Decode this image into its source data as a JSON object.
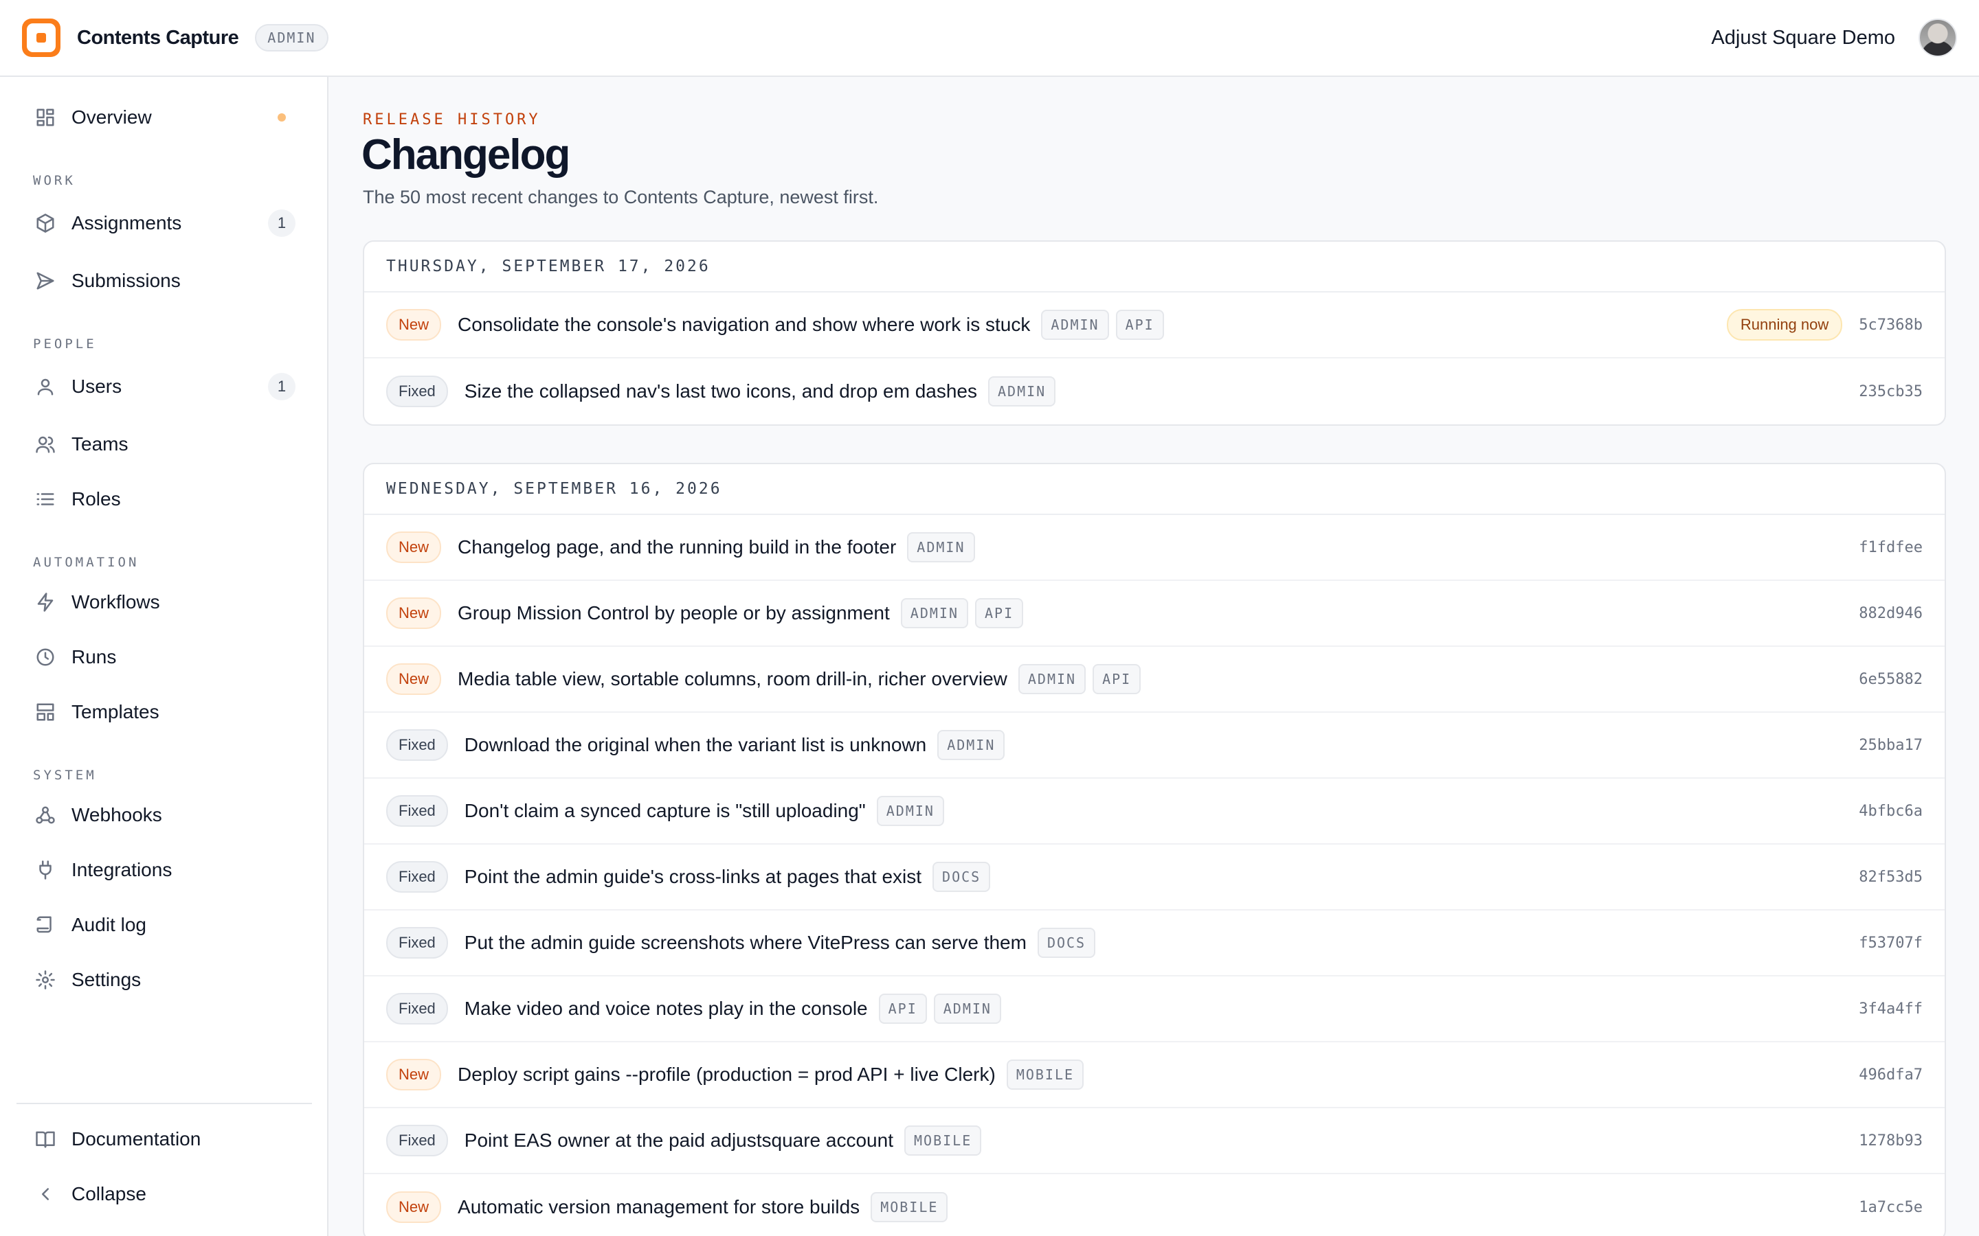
{
  "header": {
    "app_name": "Contents Capture",
    "role_badge": "ADMIN",
    "org_name": "Adjust Square Demo"
  },
  "sidebar": {
    "overview": "Overview",
    "sections": {
      "work": "WORK",
      "people": "PEOPLE",
      "automation": "AUTOMATION",
      "system": "SYSTEM"
    },
    "items": {
      "assignments": {
        "label": "Assignments",
        "count": "1",
        "icon": "box-icon"
      },
      "submissions": {
        "label": "Submissions",
        "icon": "send-icon"
      },
      "users": {
        "label": "Users",
        "count": "1",
        "icon": "user-icon"
      },
      "teams": {
        "label": "Teams",
        "icon": "users-icon"
      },
      "roles": {
        "label": "Roles",
        "icon": "list-icon"
      },
      "workflows": {
        "label": "Workflows",
        "icon": "bolt-icon"
      },
      "runs": {
        "label": "Runs",
        "icon": "clock-icon"
      },
      "templates": {
        "label": "Templates",
        "icon": "layout-icon"
      },
      "webhooks": {
        "label": "Webhooks",
        "icon": "webhook-icon"
      },
      "integrations": {
        "label": "Integrations",
        "icon": "plug-icon"
      },
      "audit_log": {
        "label": "Audit log",
        "icon": "scroll-icon"
      },
      "settings": {
        "label": "Settings",
        "icon": "gear-icon"
      }
    },
    "documentation": "Documentation",
    "collapse": "Collapse"
  },
  "page": {
    "eyebrow": "RELEASE HISTORY",
    "title": "Changelog",
    "subtitle": "The 50 most recent changes to Contents Capture, newest first."
  },
  "changelog": [
    {
      "date": "THURSDAY, SEPTEMBER 17, 2026",
      "entries": [
        {
          "kind": "New",
          "text": "Consolidate the console's navigation and show where work is stuck",
          "tags": [
            "ADMIN",
            "API"
          ],
          "status": "Running now",
          "hash": "5c7368b"
        },
        {
          "kind": "Fixed",
          "text": "Size the collapsed nav's last two icons, and drop em dashes",
          "tags": [
            "ADMIN"
          ],
          "hash": "235cb35"
        }
      ]
    },
    {
      "date": "WEDNESDAY, SEPTEMBER 16, 2026",
      "entries": [
        {
          "kind": "New",
          "text": "Changelog page, and the running build in the footer",
          "tags": [
            "ADMIN"
          ],
          "hash": "f1fdfee"
        },
        {
          "kind": "New",
          "text": "Group Mission Control by people or by assignment",
          "tags": [
            "ADMIN",
            "API"
          ],
          "hash": "882d946"
        },
        {
          "kind": "New",
          "text": "Media table view, sortable columns, room drill-in, richer overview",
          "tags": [
            "ADMIN",
            "API"
          ],
          "hash": "6e55882"
        },
        {
          "kind": "Fixed",
          "text": "Download the original when the variant list is unknown",
          "tags": [
            "ADMIN"
          ],
          "hash": "25bba17"
        },
        {
          "kind": "Fixed",
          "text": "Don't claim a synced capture is \"still uploading\"",
          "tags": [
            "ADMIN"
          ],
          "hash": "4bfbc6a"
        },
        {
          "kind": "Fixed",
          "text": "Point the admin guide's cross-links at pages that exist",
          "tags": [
            "DOCS"
          ],
          "hash": "82f53d5"
        },
        {
          "kind": "Fixed",
          "text": "Put the admin guide screenshots where VitePress can serve them",
          "tags": [
            "DOCS"
          ],
          "hash": "f53707f"
        },
        {
          "kind": "Fixed",
          "text": "Make video and voice notes play in the console",
          "tags": [
            "API",
            "ADMIN"
          ],
          "hash": "3f4a4ff"
        },
        {
          "kind": "New",
          "text": "Deploy script gains --profile (production = prod API + live Clerk)",
          "tags": [
            "MOBILE"
          ],
          "hash": "496dfa7"
        },
        {
          "kind": "Fixed",
          "text": "Point EAS owner at the paid adjustsquare account",
          "tags": [
            "MOBILE"
          ],
          "hash": "1278b93"
        },
        {
          "kind": "New",
          "text": "Automatic version management for store builds",
          "tags": [
            "MOBILE"
          ],
          "hash": "1a7cc5e"
        }
      ]
    }
  ]
}
